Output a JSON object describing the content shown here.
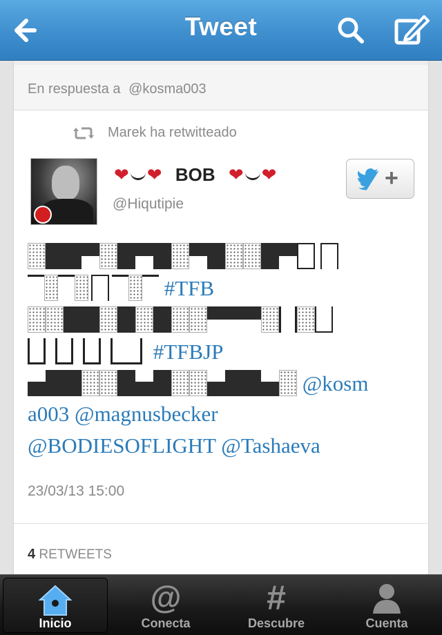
{
  "nav": {
    "title": "Tweet",
    "back_icon": "back-arrow-icon",
    "search_icon": "search-icon",
    "compose_icon": "compose-icon"
  },
  "reply": {
    "prefix": "En respuesta a",
    "user": "@kosma003"
  },
  "retweeted_by": "Marek ha retwitteado",
  "author": {
    "name": "BOB",
    "handle": "@Hiqutipie"
  },
  "tweet": {
    "hashtag1": "#TFB",
    "hashtag2": "#TFBJP",
    "mention_part1": "@kosm",
    "mention_part2": "a003",
    "mention2": "@magnusbecker",
    "mention3": "@BODIESOFLIGHT",
    "mention4": "@Tashaeva"
  },
  "timestamp": "23/03/13 15:00",
  "retweets": {
    "count": "4",
    "label": "RETWEETS"
  },
  "tabs": [
    {
      "label": "Inicio",
      "icon": "home-icon",
      "active": true
    },
    {
      "label": "Conecta",
      "icon": "at-icon",
      "active": false
    },
    {
      "label": "Descubre",
      "icon": "hash-icon",
      "active": false
    },
    {
      "label": "Cuenta",
      "icon": "person-icon",
      "active": false
    }
  ],
  "colors": {
    "nav_blue": "#3f8fcf",
    "link_blue": "#2b7bb9",
    "heart_red": "#d11f2c"
  }
}
